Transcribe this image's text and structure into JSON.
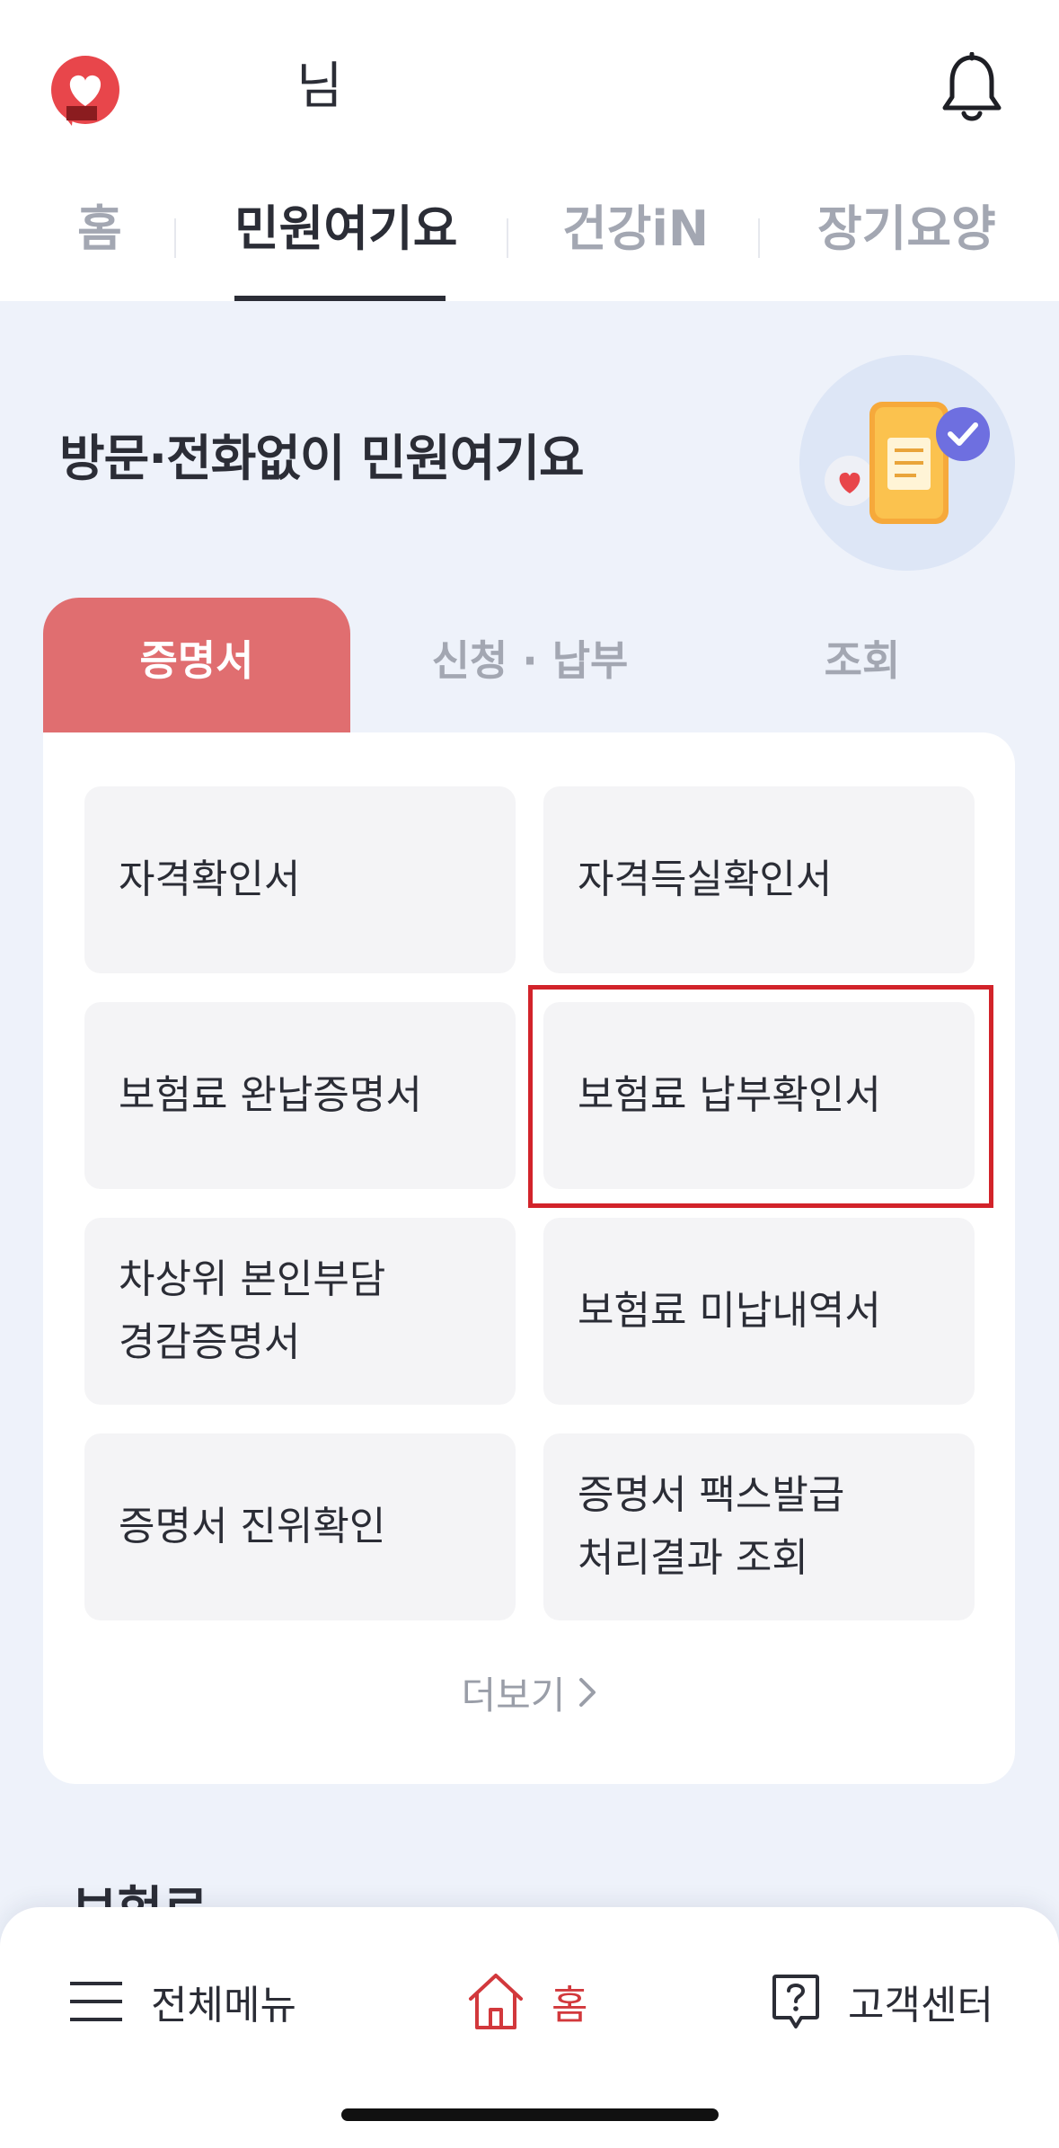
{
  "header": {
    "greeting": "님",
    "logo_icon": "heart-bubble-logo",
    "bell_icon": "bell-icon",
    "accent_color": "#e06e70"
  },
  "top_tabs": [
    {
      "label": "홈"
    },
    {
      "label": "민원여기요",
      "active": true
    },
    {
      "label": "건강iN"
    },
    {
      "label": "장기요양"
    }
  ],
  "hero": {
    "title": "방문·전화없이 민원여기요",
    "illustration": "document-check-illustration"
  },
  "category_tabs": [
    {
      "label": "증명서",
      "active": true
    },
    {
      "label": "신청 · 납부"
    },
    {
      "label": "조회"
    }
  ],
  "tiles": [
    {
      "label": "자격확인서"
    },
    {
      "label": "자격득실확인서"
    },
    {
      "label": "보험료 완납증명서"
    },
    {
      "label": "보험료 납부확인서",
      "highlighted": true
    },
    {
      "label": "차상위 본인부담\n경감증명서"
    },
    {
      "label": "보험료 미납내역서"
    },
    {
      "label": "증명서 진위확인"
    },
    {
      "label": "증명서 팩스발급\n처리결과 조회"
    }
  ],
  "more": {
    "label": "더보기",
    "icon": "chevron-right-icon"
  },
  "next_section_title": "보험료",
  "bottom_nav": [
    {
      "label": "전체메뉴",
      "icon": "hamburger-menu-icon"
    },
    {
      "label": "홈",
      "icon": "home-icon",
      "active": true
    },
    {
      "label": "고객센터",
      "icon": "question-bubble-icon"
    }
  ],
  "colors": {
    "background": "#eef2fa",
    "highlight_border": "#d2232a",
    "active_nav": "#d2383c"
  }
}
